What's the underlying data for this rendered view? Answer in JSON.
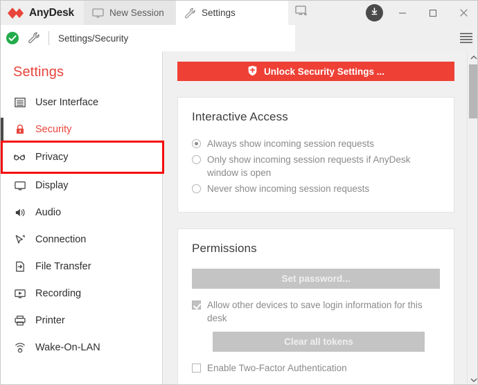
{
  "window": {
    "brand_name": "AnyDesk",
    "logo_icon": "anydesk-logo-icon",
    "tabs": [
      {
        "label": "New Session",
        "icon": "monitor-icon",
        "active": false
      },
      {
        "label": "Settings",
        "icon": "wrench-icon",
        "active": true
      }
    ],
    "new_tab_icon": "new-session-tab-icon",
    "update_icon": "download-update-icon",
    "controls": {
      "minimize": "─",
      "maximize": "□",
      "close": "✕"
    }
  },
  "addressbar": {
    "status_icon": "green-check-status-icon",
    "page_icon": "wrench-icon",
    "path": "Settings/Security",
    "menu_icon": "hamburger-menu-icon"
  },
  "sidebar": {
    "heading": "Settings",
    "items": [
      {
        "label": "User Interface",
        "icon": "window-list-icon",
        "state": "normal"
      },
      {
        "label": "Security",
        "icon": "lock-icon",
        "state": "active"
      },
      {
        "label": "Privacy",
        "icon": "glasses-icon",
        "state": "highlighted"
      },
      {
        "label": "Display",
        "icon": "monitor-icon",
        "state": "normal"
      },
      {
        "label": "Audio",
        "icon": "speaker-icon",
        "state": "normal"
      },
      {
        "label": "Connection",
        "icon": "cursor-arrow-icon",
        "state": "normal"
      },
      {
        "label": "File Transfer",
        "icon": "file-arrow-icon",
        "state": "normal"
      },
      {
        "label": "Recording",
        "icon": "play-screen-icon",
        "state": "normal"
      },
      {
        "label": "Printer",
        "icon": "printer-icon",
        "state": "normal"
      },
      {
        "label": "Wake-On-LAN",
        "icon": "wifi-power-icon",
        "state": "normal"
      }
    ]
  },
  "main": {
    "unlock_button": {
      "label": "Unlock Security Settings ...",
      "icon": "shield-icon",
      "color": "#ee4035"
    },
    "interactive_access": {
      "title": "Interactive Access",
      "options": [
        {
          "label": "Always show incoming session requests",
          "checked": true
        },
        {
          "label": "Only show incoming session requests if AnyDesk window is open",
          "checked": false
        },
        {
          "label": "Never show incoming session requests",
          "checked": false
        }
      ]
    },
    "permissions": {
      "title": "Permissions",
      "set_password_label": "Set password...",
      "save_login_label": "Allow other devices to save login information for this desk",
      "save_login_checked": true,
      "clear_tokens_label": "Clear all tokens",
      "two_factor_label": "Enable Two-Factor Authentication",
      "two_factor_checked": false
    }
  },
  "scrollbar": {
    "up_arrow": "chevron-up-icon",
    "down_arrow": "chevron-down-icon"
  },
  "colors": {
    "accent_red": "#e8453c",
    "button_red": "#ee4035",
    "highlight_red": "#f40c0c",
    "status_green": "#22ab4b",
    "disabled_grey": "#c4c4c4"
  }
}
